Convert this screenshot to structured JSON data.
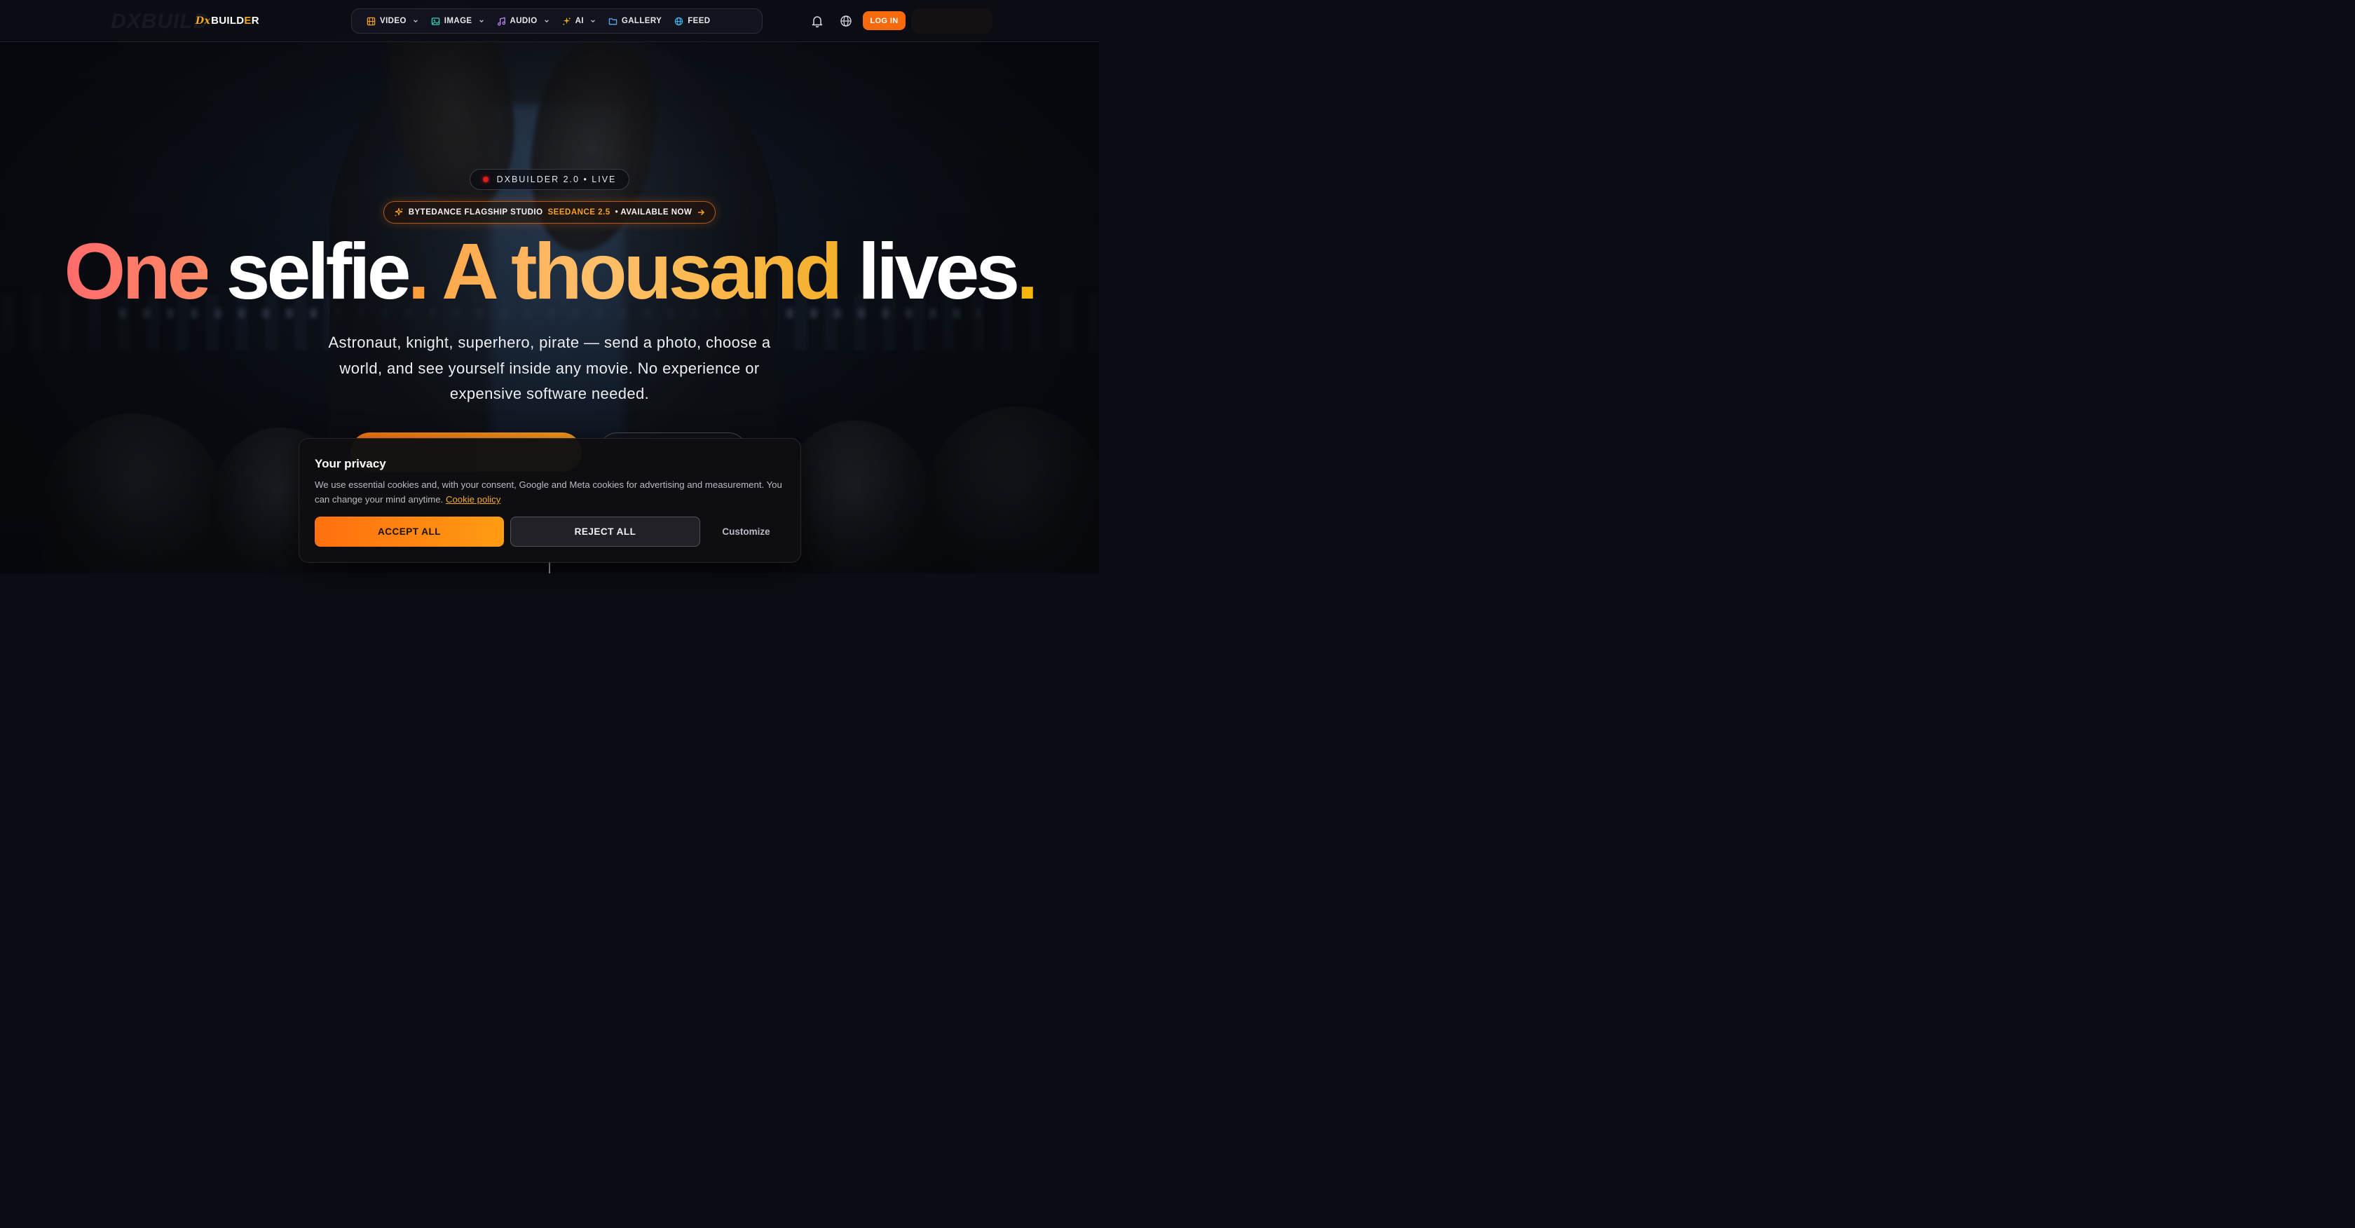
{
  "brand": {
    "logo_mark": "Dx",
    "logo_word_a": "BUILD",
    "logo_word_e": "E",
    "logo_word_r": "R"
  },
  "nav": {
    "items": [
      {
        "label": "VIDEO",
        "icon": "film-icon",
        "color": "#f5a02a",
        "dropdown": true
      },
      {
        "label": "IMAGE",
        "icon": "image-icon",
        "color": "#2dd4bf",
        "dropdown": true
      },
      {
        "label": "AUDIO",
        "icon": "music-icon",
        "color": "#c084fc",
        "dropdown": true
      },
      {
        "label": "AI",
        "icon": "sparkles-icon",
        "color": "#f5b50c",
        "dropdown": true
      },
      {
        "label": "GALLERY",
        "icon": "folder-icon",
        "color": "#60a5fa",
        "dropdown": false
      },
      {
        "label": "FEED",
        "icon": "globe-icon",
        "color": "#38bdf8",
        "dropdown": false
      }
    ],
    "login_label": "LOG IN"
  },
  "hero": {
    "live_badge": "DXBUILDER 2.0 • LIVE",
    "promo_a": "BYTEDANCE FLAGSHIP STUDIO",
    "promo_b": "SEEDANCE 2.5",
    "promo_c": "• AVAILABLE NOW",
    "headline_one": "One",
    "headline_selfie": "selfie",
    "headline_dot1": ".",
    "headline_thousand": "A thousand",
    "headline_lives": "lives",
    "headline_dot2": ".",
    "subtitle": "Astronaut, knight, superhero, pirate — send a photo, choose a world, and see yourself inside any movie. No experience or expensive software needed."
  },
  "cookie": {
    "title": "Your privacy",
    "text": "We use essential cookies and, with your consent, Google and Meta cookies for advertising and measurement. You can change your mind anytime.",
    "link": "Cookie policy",
    "accept_label": "ACCEPT ALL",
    "reject_label": "REJECT ALL",
    "customize_label": "Customize"
  },
  "colors": {
    "accent_orange": "#f46a0c",
    "accent_yellow": "#f5b50c",
    "headline_coral": "#ff6b6b"
  }
}
